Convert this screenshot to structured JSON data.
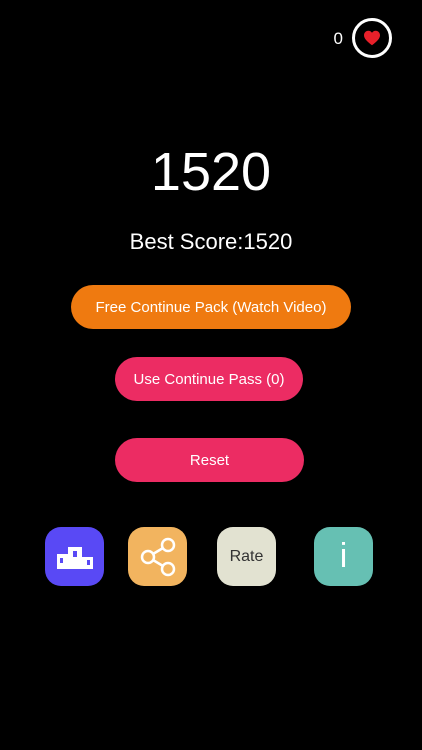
{
  "status": {
    "lives_count": "0",
    "heart_icon": "heart-icon"
  },
  "game": {
    "score": "1520",
    "best_score_label": "Best Score:1520"
  },
  "buttons": {
    "free_continue": "Free Continue Pack (Watch Video)",
    "use_continue_pass": "Use Continue Pass (0)",
    "reset": "Reset"
  },
  "bottom_icons": {
    "leaderboard_icon": "podium-icon",
    "share_icon": "share-icon",
    "rate_label": "Rate",
    "info_label": "i"
  },
  "colors": {
    "background": "#000000",
    "orange": "#ef7a10",
    "pink": "#ec2c63",
    "leaderboard": "#5949f5",
    "share": "#f2b45f",
    "rate": "#e2e2d1",
    "info": "#66c0b3",
    "heart": "#e8202a"
  }
}
